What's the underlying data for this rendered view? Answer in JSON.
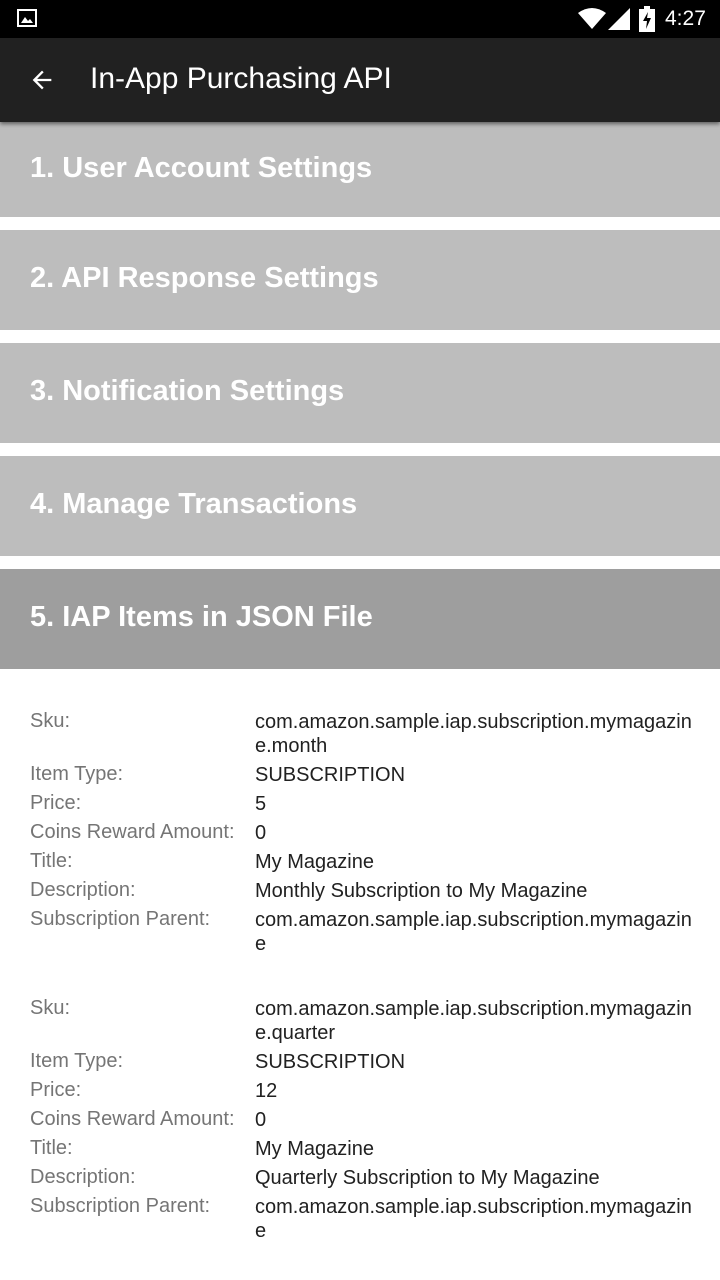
{
  "status_bar": {
    "time": "4:27",
    "icons": [
      "gallery-icon",
      "wifi-icon",
      "signal-icon",
      "battery-charging-icon"
    ]
  },
  "toolbar": {
    "back_icon": "arrow-left-icon",
    "title": "In-App Purchasing API"
  },
  "sections": [
    {
      "label": "1. User Account Settings"
    },
    {
      "label": "2. API Response Settings"
    },
    {
      "label": "3. Notification Settings"
    },
    {
      "label": "4. Manage Transactions"
    },
    {
      "label": "5. IAP Items in JSON File"
    }
  ],
  "field_labels": {
    "sku": "Sku:",
    "item_type": "Item Type:",
    "price": "Price:",
    "coins": "Coins Reward Amount:",
    "title": "Title:",
    "description": "Description:",
    "parent": "Subscription Parent:"
  },
  "items": [
    {
      "sku": "com.amazon.sample.iap.subscription.mymagazine.month",
      "item_type": "SUBSCRIPTION",
      "price": "5",
      "coins": "0",
      "title": "My Magazine",
      "description": "Monthly Subscription to My Magazine",
      "parent": "com.amazon.sample.iap.subscription.mymagazine"
    },
    {
      "sku": "com.amazon.sample.iap.subscription.mymagazine.quarter",
      "item_type": "SUBSCRIPTION",
      "price": "12",
      "coins": "0",
      "title": "My Magazine",
      "description": "Quarterly Subscription to My Magazine",
      "parent": "com.amazon.sample.iap.subscription.mymagazine"
    }
  ],
  "colors": {
    "section_bg": "#bdbdbd",
    "section_active_bg": "#9e9e9e",
    "toolbar_bg": "#212121"
  }
}
